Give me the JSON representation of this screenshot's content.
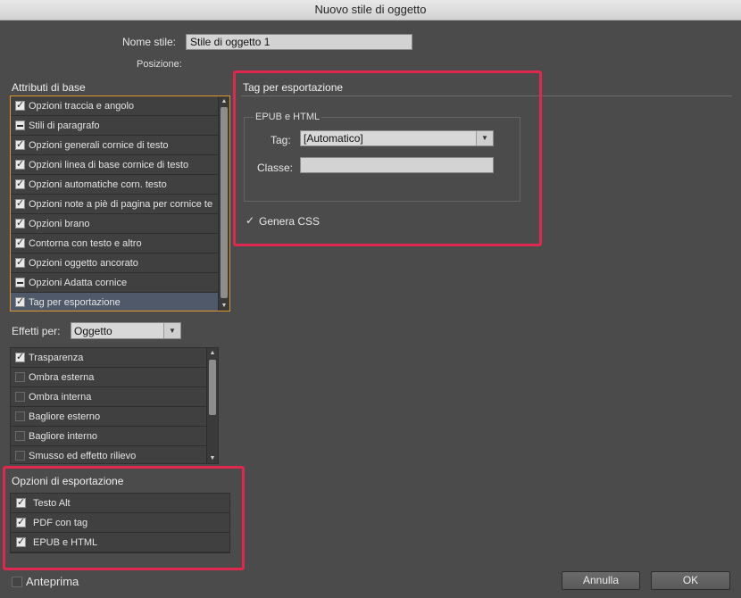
{
  "window": {
    "title": "Nuovo stile di oggetto"
  },
  "header": {
    "style_name_label": "Nome stile:",
    "style_name_value": "Stile di oggetto 1",
    "position_label": "Posizione:"
  },
  "basic_attributes": {
    "title": "Attributi di base",
    "items": [
      {
        "label": "Opzioni traccia e angolo",
        "state": "checked"
      },
      {
        "label": "Stili di paragrafo",
        "state": "mixed"
      },
      {
        "label": "Opzioni generali cornice di testo",
        "state": "checked"
      },
      {
        "label": "Opzioni linea di base cornice di testo",
        "state": "checked"
      },
      {
        "label": "Opzioni automatiche corn. testo",
        "state": "checked"
      },
      {
        "label": "Opzioni note a piè di pagina per cornice te",
        "state": "checked"
      },
      {
        "label": "Opzioni brano",
        "state": "checked"
      },
      {
        "label": "Contorna con testo e altro",
        "state": "checked"
      },
      {
        "label": "Opzioni oggetto ancorato",
        "state": "checked"
      },
      {
        "label": "Opzioni Adatta cornice",
        "state": "mixed"
      },
      {
        "label": "Tag per esportazione",
        "state": "checked",
        "selected": true
      }
    ]
  },
  "effects": {
    "label": "Effetti per:",
    "selected": "Oggetto",
    "items": [
      {
        "label": "Trasparenza",
        "state": "checked"
      },
      {
        "label": "Ombra esterna",
        "state": "unchecked"
      },
      {
        "label": "Ombra interna",
        "state": "unchecked"
      },
      {
        "label": "Bagliore esterno",
        "state": "unchecked"
      },
      {
        "label": "Bagliore interno",
        "state": "unchecked"
      },
      {
        "label": "Smusso ed effetto rilievo",
        "state": "unchecked"
      }
    ]
  },
  "export_options": {
    "title": "Opzioni di esportazione",
    "items": [
      {
        "label": "Testo Alt",
        "state": "checked"
      },
      {
        "label": "PDF con tag",
        "state": "checked"
      },
      {
        "label": "EPUB e HTML",
        "state": "checked"
      }
    ]
  },
  "export_tags": {
    "title": "Tag per esportazione",
    "group_title": "EPUB e HTML",
    "tag_label": "Tag:",
    "tag_value": "[Automatico]",
    "class_label": "Classe:",
    "class_value": "",
    "generate_css_label": "Genera CSS",
    "generate_css_checked": true
  },
  "footer": {
    "preview_label": "Anteprima",
    "preview_checked": false,
    "cancel_label": "Annulla",
    "ok_label": "OK"
  },
  "colors": {
    "dialog_bg": "#4b4b4b",
    "highlight_red": "#e0284f",
    "selected_row": "#4f596a"
  }
}
